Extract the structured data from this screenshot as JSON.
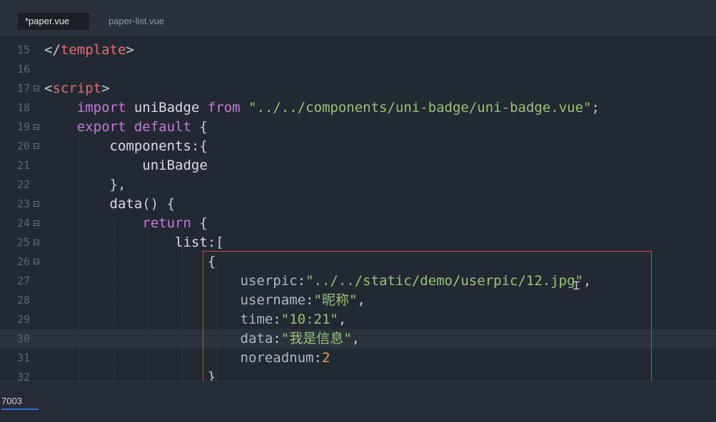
{
  "tabs": [
    {
      "label": "*paper.vue",
      "active": true
    },
    {
      "label": "paper-list.vue",
      "active": false
    }
  ],
  "editor": {
    "lines": [
      {
        "num": "15",
        "tokens": [
          [
            "t-br",
            "</"
          ],
          [
            "t-tag",
            "template"
          ],
          [
            "t-br",
            ">"
          ]
        ]
      },
      {
        "num": "16",
        "tokens": []
      },
      {
        "num": "17",
        "fold": true,
        "tokens": [
          [
            "t-br",
            "<"
          ],
          [
            "t-tag",
            "script"
          ],
          [
            "t-br",
            ">"
          ]
        ]
      },
      {
        "num": "18",
        "tokens": [
          [
            "t-id",
            "    "
          ],
          [
            "t-kw",
            "import"
          ],
          [
            "t-id",
            " uniBadge "
          ],
          [
            "t-kw",
            "from"
          ],
          [
            "t-id",
            " "
          ],
          [
            "t-str",
            "\"../../components/uni-badge/uni-badge.vue\""
          ],
          [
            "t-punc",
            ";"
          ]
        ]
      },
      {
        "num": "19",
        "fold": true,
        "tokens": [
          [
            "t-id",
            "    "
          ],
          [
            "t-kw",
            "export"
          ],
          [
            "t-id",
            " "
          ],
          [
            "t-kw",
            "default"
          ],
          [
            "t-punc",
            " {"
          ]
        ]
      },
      {
        "num": "20",
        "fold": true,
        "tokens": [
          [
            "t-id",
            "        components"
          ],
          [
            "t-punc",
            ":{"
          ]
        ]
      },
      {
        "num": "21",
        "tokens": [
          [
            "t-id",
            "            uniBadge"
          ]
        ]
      },
      {
        "num": "22",
        "tokens": [
          [
            "t-punc",
            "        },"
          ]
        ]
      },
      {
        "num": "23",
        "fold": true,
        "tokens": [
          [
            "t-id",
            "        data"
          ],
          [
            "t-punc",
            "() {"
          ]
        ]
      },
      {
        "num": "24",
        "fold": true,
        "tokens": [
          [
            "t-id",
            "            "
          ],
          [
            "t-kw",
            "return"
          ],
          [
            "t-punc",
            " {"
          ]
        ]
      },
      {
        "num": "25",
        "fold": true,
        "tokens": [
          [
            "t-id",
            "                list"
          ],
          [
            "t-punc",
            ":["
          ]
        ]
      },
      {
        "num": "26",
        "fold": true,
        "tokens": [
          [
            "t-punc",
            "                    {"
          ]
        ]
      },
      {
        "num": "27",
        "tokens": [
          [
            "t-prop",
            "                        userpic"
          ],
          [
            "t-punc",
            ":"
          ],
          [
            "t-str",
            "\"../../static/demo/userpic/12.jpg\""
          ],
          [
            "t-punc",
            ","
          ]
        ]
      },
      {
        "num": "28",
        "tokens": [
          [
            "t-prop",
            "                        username"
          ],
          [
            "t-punc",
            ":"
          ],
          [
            "t-str",
            "\"昵称\""
          ],
          [
            "t-punc",
            ","
          ]
        ]
      },
      {
        "num": "29",
        "tokens": [
          [
            "t-prop",
            "                        time"
          ],
          [
            "t-punc",
            ":"
          ],
          [
            "t-str",
            "\"10:21\""
          ],
          [
            "t-punc",
            ","
          ]
        ]
      },
      {
        "num": "30",
        "current": true,
        "tokens": [
          [
            "t-prop",
            "                        data"
          ],
          [
            "t-punc",
            ":"
          ],
          [
            "t-str",
            "\"我是信息\""
          ],
          [
            "t-punc",
            ","
          ]
        ]
      },
      {
        "num": "31",
        "tokens": [
          [
            "t-prop",
            "                        noreadnum"
          ],
          [
            "t-punc",
            ":"
          ],
          [
            "t-num",
            "2"
          ]
        ]
      },
      {
        "num": "32",
        "tokens": [
          [
            "t-punc",
            "                    }"
          ]
        ]
      }
    ]
  },
  "status": {
    "port": "7003"
  },
  "colors": {
    "highlight_box": "#e0403f",
    "background": "#232932"
  }
}
